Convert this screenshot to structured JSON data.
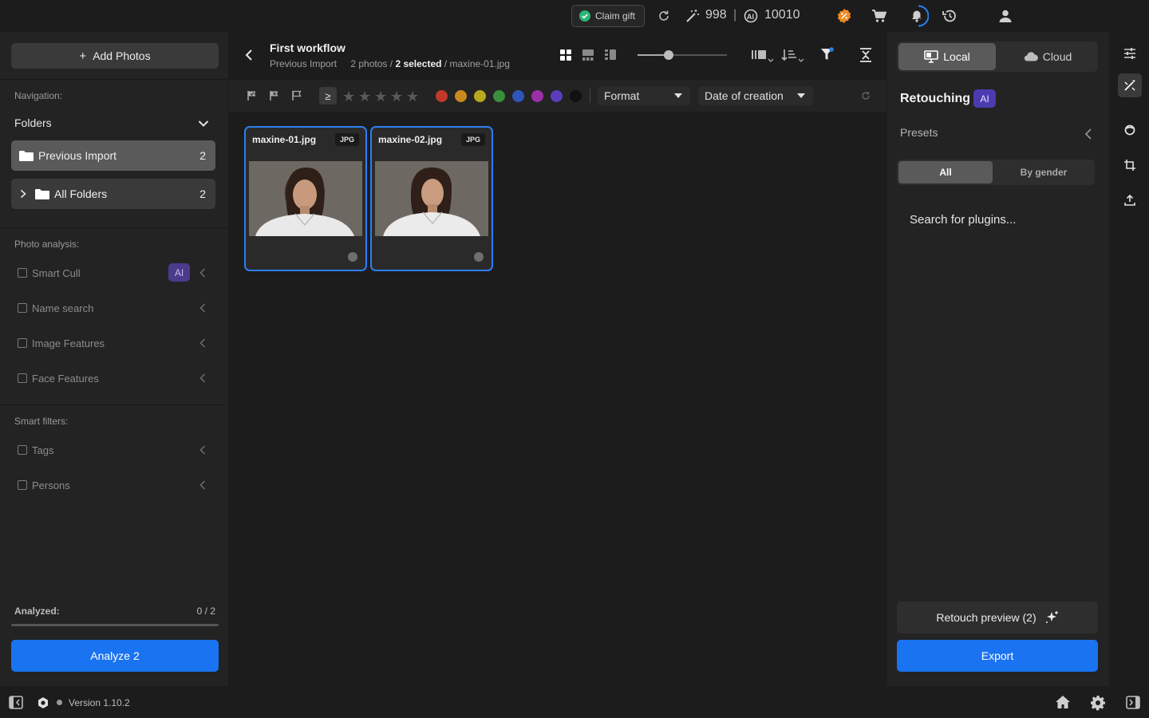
{
  "topbar": {
    "claim_gift": "Claim gift",
    "credits_magic": "998",
    "separator": "|",
    "credits_ai": "10010"
  },
  "left": {
    "add_photos": "Add Photos",
    "navigation_label": "Navigation:",
    "folders_label": "Folders",
    "folders": [
      {
        "label": "Previous Import",
        "count": "2"
      },
      {
        "label": "All Folders",
        "count": "2"
      }
    ],
    "photo_analysis_label": "Photo analysis:",
    "analysis_items": [
      {
        "label": "Smart Cull",
        "badge": "AI"
      },
      {
        "label": "Name search"
      },
      {
        "label": "Image Features"
      },
      {
        "label": "Face Features"
      }
    ],
    "smart_filters_label": "Smart filters:",
    "smart_filters": [
      {
        "label": "Tags"
      },
      {
        "label": "Persons"
      }
    ],
    "analyzed_label": "Analyzed:",
    "analyzed_value": "0 / 2",
    "analyzed_fraction": 0,
    "analyze_button": "Analyze 2"
  },
  "center": {
    "title": "First workflow",
    "crumb_folder": "Previous Import",
    "crumb_count": "2 photos /",
    "crumb_selected": "2 selected",
    "crumb_file": "/ maxine-01.jpg",
    "ge_symbol": "≥",
    "color_labels": [
      "#c0392b",
      "#c98a1d",
      "#b8a81e",
      "#3b8f3b",
      "#2f55b8",
      "#9b2fa8",
      "#5b3dbb",
      "#111111"
    ],
    "format_dropdown": "Format",
    "date_dropdown": "Date of creation",
    "photos": [
      {
        "name": "maxine-01.jpg",
        "format": "JPG"
      },
      {
        "name": "maxine-02.jpg",
        "format": "JPG"
      }
    ]
  },
  "right": {
    "tab_local": "Local",
    "tab_cloud": "Cloud",
    "retouching": "Retouching",
    "ai_badge": "AI",
    "presets": "Presets",
    "filter_all": "All",
    "filter_gender": "By gender",
    "search_plugins": "Search for plugins...",
    "retouch_preview": "Retouch preview (2)",
    "export": "Export"
  },
  "bottom": {
    "version": "Version 1.10.2"
  },
  "colors": {
    "accent": "#1a73f0",
    "selection": "#2d7ef0",
    "ai_badge": "#4a3b8c",
    "discount": "#f08a24",
    "claim_check": "#2bb673"
  }
}
